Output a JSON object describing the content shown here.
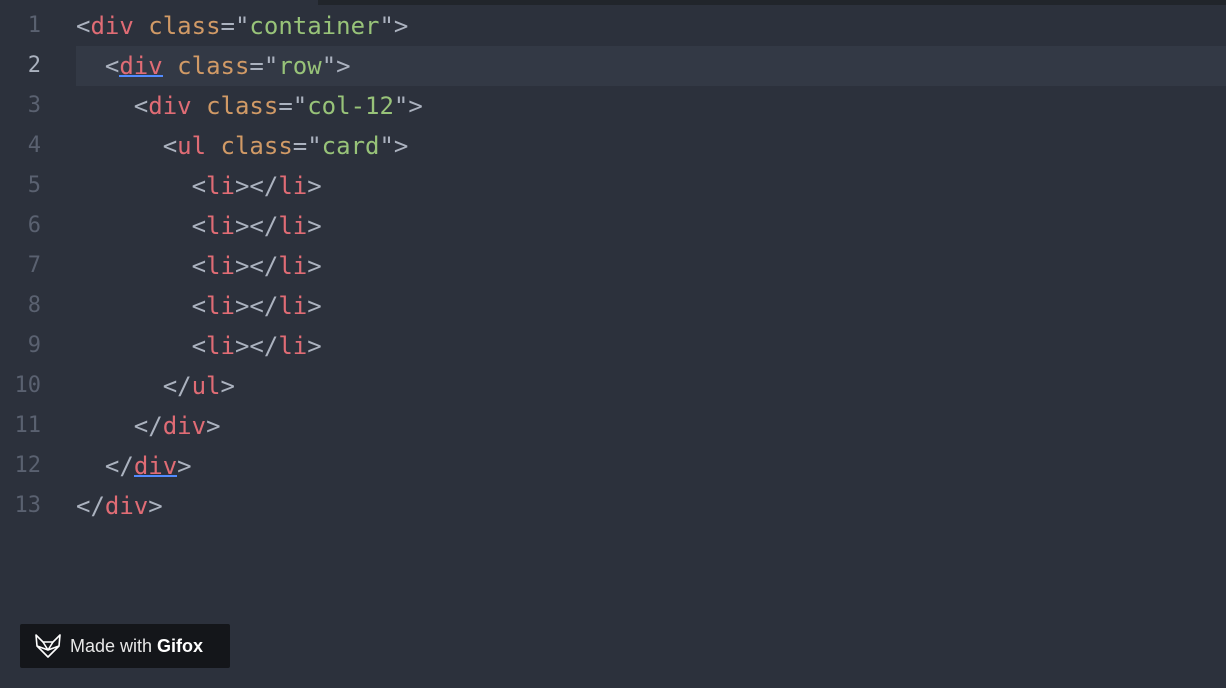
{
  "colors": {
    "background": "#2c313c",
    "tag": "#e06c75",
    "attribute": "#d19a66",
    "string": "#98c379",
    "punctuation": "#abb2bf",
    "line_number": "#5a6170",
    "bracket_match_underline": "#528bff"
  },
  "editor": {
    "active_line": 2,
    "lines": [
      {
        "n": "1",
        "indent": "",
        "tokens": [
          [
            "punct",
            "<"
          ],
          [
            "tag",
            "div"
          ],
          [
            "punct",
            " "
          ],
          [
            "attr",
            "class"
          ],
          [
            "punct",
            "=\""
          ],
          [
            "str",
            "container"
          ],
          [
            "punct",
            "\">"
          ]
        ]
      },
      {
        "n": "2",
        "indent": "  ",
        "tokens": [
          [
            "punct",
            "<"
          ],
          [
            "tag-match",
            "div"
          ],
          [
            "punct",
            " "
          ],
          [
            "attr",
            "class"
          ],
          [
            "punct",
            "=\""
          ],
          [
            "str",
            "row"
          ],
          [
            "punct",
            "\">"
          ]
        ]
      },
      {
        "n": "3",
        "indent": "    ",
        "tokens": [
          [
            "punct",
            "<"
          ],
          [
            "tag",
            "div"
          ],
          [
            "punct",
            " "
          ],
          [
            "attr",
            "class"
          ],
          [
            "punct",
            "=\""
          ],
          [
            "str",
            "col-12"
          ],
          [
            "punct",
            "\">"
          ]
        ]
      },
      {
        "n": "4",
        "indent": "      ",
        "tokens": [
          [
            "punct",
            "<"
          ],
          [
            "tag",
            "ul"
          ],
          [
            "punct",
            " "
          ],
          [
            "attr",
            "class"
          ],
          [
            "punct",
            "=\""
          ],
          [
            "str",
            "card"
          ],
          [
            "punct",
            "\">"
          ]
        ]
      },
      {
        "n": "5",
        "indent": "        ",
        "tokens": [
          [
            "punct",
            "<"
          ],
          [
            "tag",
            "li"
          ],
          [
            "punct",
            "></"
          ],
          [
            "tag",
            "li"
          ],
          [
            "punct",
            ">"
          ]
        ]
      },
      {
        "n": "6",
        "indent": "        ",
        "tokens": [
          [
            "punct",
            "<"
          ],
          [
            "tag",
            "li"
          ],
          [
            "punct",
            "></"
          ],
          [
            "tag",
            "li"
          ],
          [
            "punct",
            ">"
          ]
        ]
      },
      {
        "n": "7",
        "indent": "        ",
        "tokens": [
          [
            "punct",
            "<"
          ],
          [
            "tag",
            "li"
          ],
          [
            "punct",
            "></"
          ],
          [
            "tag",
            "li"
          ],
          [
            "punct",
            ">"
          ]
        ]
      },
      {
        "n": "8",
        "indent": "        ",
        "tokens": [
          [
            "punct",
            "<"
          ],
          [
            "tag",
            "li"
          ],
          [
            "punct",
            "></"
          ],
          [
            "tag",
            "li"
          ],
          [
            "punct",
            ">"
          ]
        ]
      },
      {
        "n": "9",
        "indent": "        ",
        "tokens": [
          [
            "punct",
            "<"
          ],
          [
            "tag",
            "li"
          ],
          [
            "punct",
            "></"
          ],
          [
            "tag",
            "li"
          ],
          [
            "punct",
            ">"
          ]
        ]
      },
      {
        "n": "10",
        "indent": "      ",
        "tokens": [
          [
            "punct",
            "</"
          ],
          [
            "tag",
            "ul"
          ],
          [
            "punct",
            ">"
          ]
        ]
      },
      {
        "n": "11",
        "indent": "    ",
        "tokens": [
          [
            "punct",
            "</"
          ],
          [
            "tag",
            "div"
          ],
          [
            "punct",
            ">"
          ]
        ]
      },
      {
        "n": "12",
        "indent": "  ",
        "tokens": [
          [
            "punct",
            "</"
          ],
          [
            "tag-match",
            "div"
          ],
          [
            "punct",
            ">"
          ]
        ]
      },
      {
        "n": "13",
        "indent": "",
        "tokens": [
          [
            "punct",
            "</"
          ],
          [
            "tag",
            "div"
          ],
          [
            "punct",
            ">"
          ]
        ]
      }
    ]
  },
  "badge": {
    "icon": "fox-logo-icon",
    "prefix": "Made with",
    "brand": "Gifox"
  }
}
